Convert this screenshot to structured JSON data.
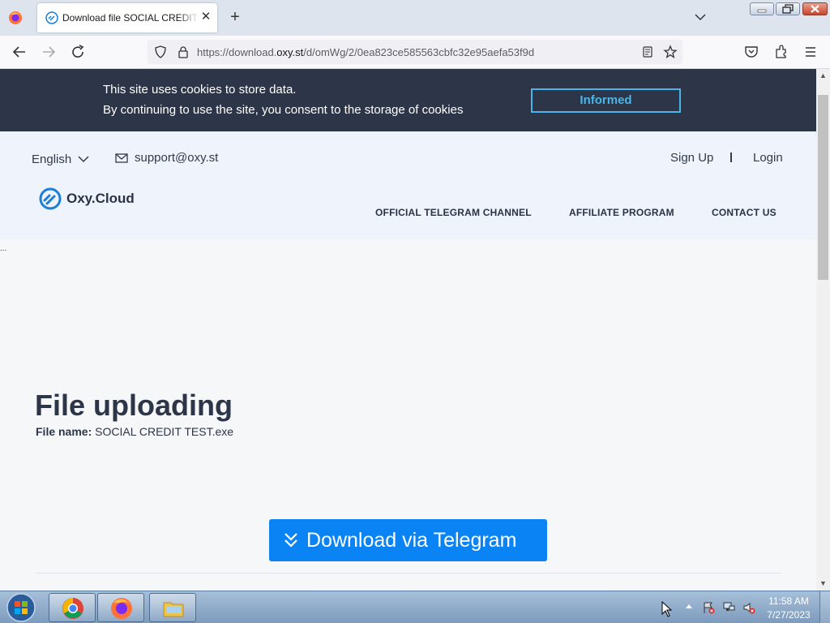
{
  "browser": {
    "tab_title": "Download file SOCIAL CREDIT TEST.exe",
    "url_prefix": "https://download.",
    "url_host": "oxy.st",
    "url_path": "/d/omWg/2/0ea823ce585563cbfc32e95aefa53f9d",
    "tab_close_glyph": "✕",
    "new_tab_glyph": "+"
  },
  "cookie_banner": {
    "line1": "This site uses cookies to store data.",
    "line2": "By continuing to use the site, you consent to the storage of cookies",
    "button_label": "Informed"
  },
  "header": {
    "language": "English",
    "support_email": "support@oxy.st",
    "signup_label": "Sign Up",
    "login_label": "Login",
    "logo_text": "Oxy.Cloud",
    "nav": {
      "telegram": "OFFICIAL TELEGRAM CHANNEL",
      "affiliate": "AFFILIATE PROGRAM",
      "contact": "CONTACT US"
    }
  },
  "page": {
    "dots": "...",
    "heading": "File uploading",
    "file_name_label": "File name:",
    "file_name_value": "SOCIAL CREDIT TEST.exe",
    "download_label": "Download via Telegram"
  },
  "taskbar": {
    "time": "11:58 AM",
    "date": "7/27/2023"
  },
  "colors": {
    "banner_bg": "#2d3548",
    "banner_button": "#48b6e8",
    "header_bg": "#eef3fc",
    "download_button": "#0a84f5",
    "text_dark": "#2d3548"
  },
  "icons": [
    "firefox-icon",
    "oxy-favicon-icon",
    "back-arrow-icon",
    "forward-arrow-icon",
    "reload-icon",
    "shield-icon",
    "lock-icon",
    "reader-view-icon",
    "bookmark-star-icon",
    "pocket-icon",
    "extensions-icon",
    "hamburger-menu-icon",
    "chevron-down-icon",
    "mail-icon",
    "oxy-logo-icon",
    "double-chevron-down-icon",
    "windows-start-icon",
    "chrome-icon",
    "folder-icon"
  ]
}
